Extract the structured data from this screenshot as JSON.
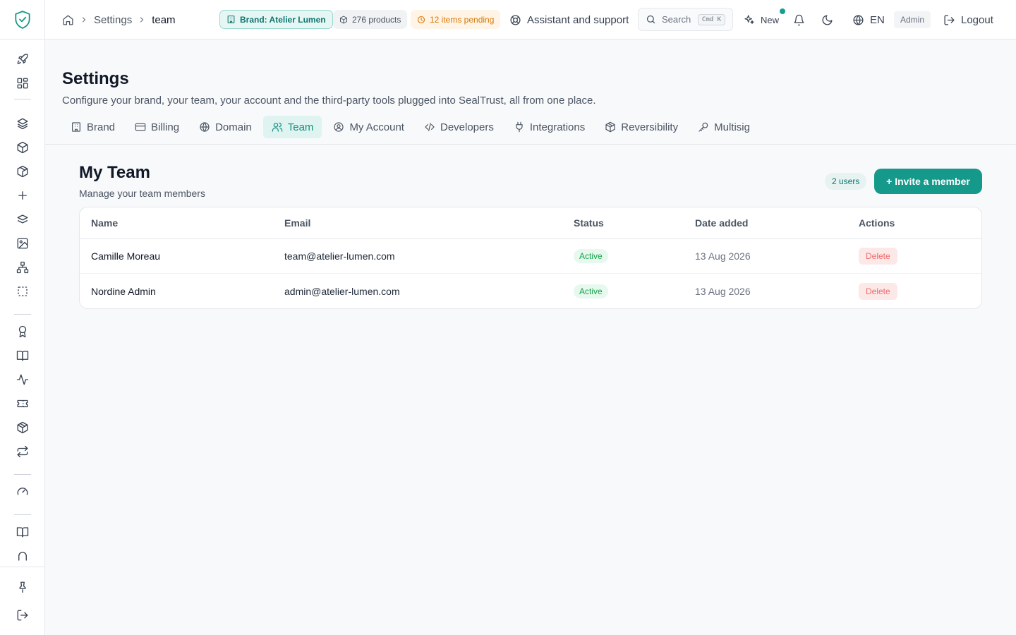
{
  "header": {
    "breadcrumb": {
      "home_icon": "home-icon",
      "items": [
        "Settings",
        "team"
      ]
    },
    "brand_pill": "Brand: Atelier Lumen",
    "products_pill": "276 products",
    "pending_pill": "12 items pending",
    "assistant_label": "Assistant and support",
    "search": {
      "label": "Search",
      "shortcut": "Cmd K"
    },
    "new_label": "New",
    "language": "EN",
    "role": "Admin",
    "logout_label": "Logout"
  },
  "page": {
    "title": "Settings",
    "subtitle": "Configure your brand, your team, your account and the third-party tools plugged into SealTrust, all from one place.",
    "tabs": [
      {
        "label": "Brand",
        "icon": "building-icon"
      },
      {
        "label": "Billing",
        "icon": "credit-card-icon"
      },
      {
        "label": "Domain",
        "icon": "globe-icon"
      },
      {
        "label": "Team",
        "icon": "users-icon",
        "active": true
      },
      {
        "label": "My Account",
        "icon": "user-circle-icon"
      },
      {
        "label": "Developers",
        "icon": "code-icon"
      },
      {
        "label": "Integrations",
        "icon": "plug-icon"
      },
      {
        "label": "Reversibility",
        "icon": "package-icon"
      },
      {
        "label": "Multisig",
        "icon": "key-icon"
      }
    ]
  },
  "team": {
    "title": "My Team",
    "subtitle": "Manage your team members",
    "users_count": "2 users",
    "invite_label": "+ Invite a member",
    "columns": [
      "Name",
      "Email",
      "Status",
      "Date added",
      "Actions"
    ],
    "rows": [
      {
        "name": "Camille Moreau",
        "email": "team@atelier-lumen.com",
        "status": "Active",
        "date_added": "13 Aug 2026",
        "action": "Delete"
      },
      {
        "name": "Nordine Admin",
        "email": "admin@atelier-lumen.com",
        "status": "Active",
        "date_added": "13 Aug 2026",
        "action": "Delete"
      }
    ]
  },
  "colors": {
    "accent": "#14998b",
    "accent_light": "#dff3f0",
    "status_active": "#16a34a",
    "danger": "#ef6a6a",
    "pending": "#d97706"
  },
  "sidebar": {
    "icons": [
      "rocket-icon",
      "dashboard-icon",
      "layers-icon",
      "box-icon",
      "box-outline-icon",
      "plus-icon",
      "layers-stack-icon",
      "image-icon",
      "hierarchy-icon",
      "selection-icon",
      "award-icon",
      "book-open-icon",
      "activity-icon",
      "ticket-icon",
      "package-icon",
      "repeat-icon",
      "gauge-icon",
      "book-icon",
      "arch-icon",
      "pin-icon",
      "logout-icon"
    ]
  }
}
